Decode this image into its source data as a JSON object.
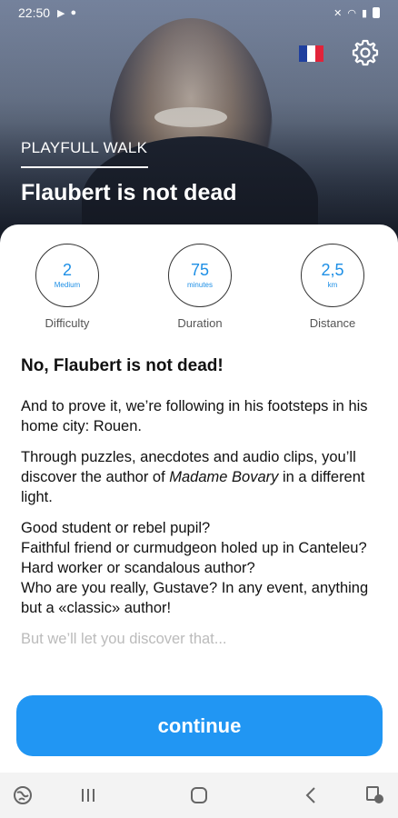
{
  "status_bar": {
    "time": "22:50"
  },
  "hero": {
    "tag": "PLAYFULL WALK",
    "title": "Flaubert is not dead"
  },
  "stats": [
    {
      "value": "2",
      "unit": "Medium",
      "label": "Difficulty"
    },
    {
      "value": "75",
      "unit": "minutes",
      "label": "Duration"
    },
    {
      "value": "2,5",
      "unit": "km",
      "label": "Distance"
    }
  ],
  "content": {
    "heading": "No, Flaubert is not dead!",
    "p1": "And to prove it, we’re following in his footsteps in his home city: Rouen.",
    "p2_before": "Through puzzles, anecdotes and audio clips, you’ll discover the author of ",
    "p2_italic": "Madame Bovary",
    "p2_after": " in a different light.",
    "p3_l1": "Good student or rebel pupil?",
    "p3_l2": "Faithful friend or curmudgeon holed up in Canteleu?",
    "p3_l3": "Hard worker or scandalous author?",
    "p3_l4": "Who are you really, Gustave? In any event, anything but a «classic» author!",
    "p4": "But we’ll let you discover that..."
  },
  "continue_label": "continue",
  "colors": {
    "accent": "#2196f3",
    "stat_value": "#1d8fe6"
  },
  "icons": [
    "play-icon",
    "circle-icon",
    "mute-icon",
    "wifi-icon",
    "signal-icon",
    "battery-icon",
    "french-flag-icon",
    "gear-icon",
    "globe-icon",
    "recents-icon",
    "home-icon",
    "back-icon",
    "accessibility-icon"
  ]
}
